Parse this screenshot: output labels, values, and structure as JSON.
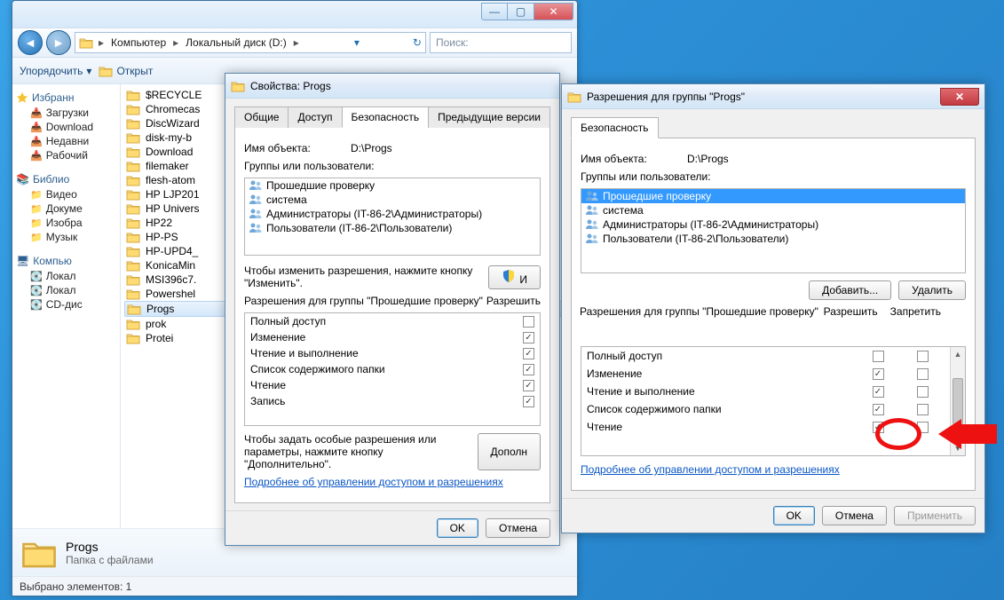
{
  "explorer": {
    "breadcrumb": [
      "Компьютер",
      "Локальный диск (D:)"
    ],
    "search_placeholder": "Поиск:",
    "toolbar": {
      "organize": "Упорядочить",
      "open": "Открыт"
    },
    "sidebar": {
      "fav_header": "Избранн",
      "favs": [
        "Загрузки",
        "Download",
        "Недавни",
        "Рабочий"
      ],
      "lib_header": "Библио",
      "libs": [
        "Видео",
        "Докуме",
        "Изобра",
        "Музык"
      ],
      "comp_header": "Компью",
      "comps": [
        "Локал",
        "Локал",
        "CD-дис"
      ]
    },
    "files": [
      "$RECYCLE",
      "Chromecas",
      "DiscWizard",
      "disk-my-b",
      "Download",
      "filemaker",
      "flesh-atom",
      "HP LJP201",
      "HP Univers",
      "HP22",
      "HP-PS",
      "HP-UPD4_",
      "KonicaMin",
      "MSI396c7.",
      "Powershel",
      "Progs",
      "prok",
      "Protei"
    ],
    "selected_file": "Progs",
    "details": {
      "name": "Progs",
      "type": "Папка с файлами"
    },
    "status": "Выбрано элементов: 1"
  },
  "properties": {
    "title": "Свойства: Progs",
    "tabs": [
      "Общие",
      "Доступ",
      "Безопасность",
      "Предыдущие версии"
    ],
    "active_tab": 2,
    "object_label": "Имя объекта:",
    "object_path": "D:\\Progs",
    "groups_label": "Группы или пользователи:",
    "users": [
      "Прошедшие проверку",
      "система",
      "Администраторы (IT-86-2\\Администраторы)",
      "Пользователи (IT-86-2\\Пользователи)"
    ],
    "edit_hint": "Чтобы изменить разрешения, нажмите кнопку \"Изменить\".",
    "edit_btn": "И",
    "perms_label": "Разрешения для группы \"Прошедшие проверку\"",
    "col_allow": "Разрешить",
    "perms": [
      {
        "name": "Полный доступ",
        "allow": false
      },
      {
        "name": "Изменение",
        "allow": true
      },
      {
        "name": "Чтение и выполнение",
        "allow": true
      },
      {
        "name": "Список содержимого папки",
        "allow": true
      },
      {
        "name": "Чтение",
        "allow": true
      },
      {
        "name": "Запись",
        "allow": true
      }
    ],
    "advanced_hint": "Чтобы задать особые разрешения или параметры, нажмите кнопку \"Дополнительно\".",
    "advanced_btn": "Дополн",
    "learn_link": "Подробнее об управлении доступом и разрешениях",
    "ok": "OK",
    "cancel": "Отмена"
  },
  "perms_editor": {
    "title": "Разрешения для группы \"Progs\"",
    "tab": "Безопасность",
    "object_label": "Имя объекта:",
    "object_path": "D:\\Progs",
    "groups_label": "Группы или пользователи:",
    "users": [
      "Прошедшие проверку",
      "система",
      "Администраторы (IT-86-2\\Администраторы)",
      "Пользователи (IT-86-2\\Пользователи)"
    ],
    "selected_user": 0,
    "add_btn": "Добавить...",
    "remove_btn": "Удалить",
    "perms_label": "Разрешения для группы \"Прошедшие проверку\"",
    "col_allow": "Разрешить",
    "col_deny": "Запретить",
    "perms": [
      {
        "name": "Полный доступ",
        "allow": false,
        "deny": false
      },
      {
        "name": "Изменение",
        "allow": true,
        "deny": false
      },
      {
        "name": "Чтение и выполнение",
        "allow": true,
        "deny": false
      },
      {
        "name": "Список содержимого папки",
        "allow": true,
        "deny": false
      },
      {
        "name": "Чтение",
        "allow": true,
        "deny": false
      }
    ],
    "learn_link": "Подробнее об управлении доступом и разрешениях",
    "ok": "OK",
    "cancel": "Отмена",
    "apply": "Применить"
  }
}
